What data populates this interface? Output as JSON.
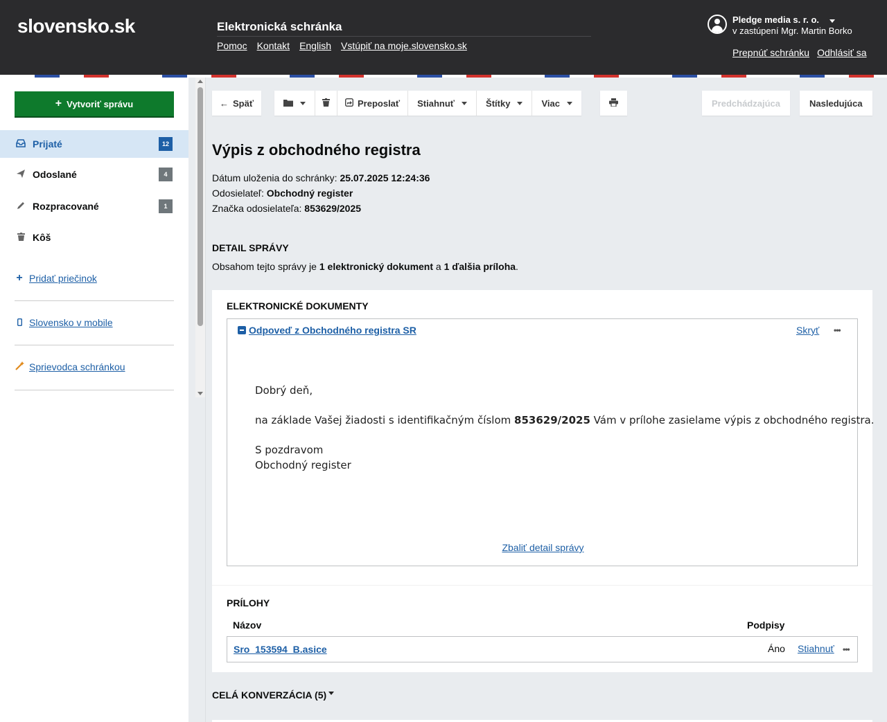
{
  "header": {
    "logo": "slovensko.sk",
    "app_title": "Elektronická schránka",
    "links": [
      "Pomoc",
      "Kontakt",
      "English",
      "Vstúpiť na moje.slovensko.sk"
    ],
    "user_name": "Pledge media s. r. o.",
    "user_sub": "v zastúpení Mgr. Martin Borko",
    "switch_link": "Prepnúť schránku",
    "logout_link": "Odhlásiť sa"
  },
  "sidebar": {
    "create_button": "Vytvoriť správu",
    "items": [
      {
        "label": "Prijaté",
        "count": "12",
        "icon": "inbox-icon",
        "active": true
      },
      {
        "label": "Odoslané",
        "count": "4",
        "icon": "paper-plane-icon"
      },
      {
        "label": "Rozpracované",
        "count": "1",
        "icon": "pencil-icon"
      },
      {
        "label": "Kôš",
        "count": "",
        "icon": "trash-icon"
      }
    ],
    "add_folder": "Pridať priečinok",
    "mobile": "Slovensko v mobile",
    "guide": "Sprievodca schránkou"
  },
  "toolbar": {
    "back": "Späť",
    "forward": "Preposlať",
    "download": "Stiahnuť",
    "tags": "Štítky",
    "more": "Viac",
    "previous": "Predchádzajúca",
    "next": "Nasledujúca"
  },
  "message": {
    "title": "Výpis z obchodného registra",
    "date_label": "Dátum uloženia do schránky:",
    "date_value": "25.07.2025 12:24:36",
    "sender_label": "Odosielateľ:",
    "sender_value": "Obchodný register",
    "ref_label": "Značka odosielateľa:",
    "ref_value": "853629/2025",
    "detail_title": "DETAIL SPRÁVY",
    "summary_pre": "Obsahom tejto správy je",
    "summary_docs": "1 elektronický dokument",
    "summary_mid": "a",
    "summary_att": "1 ďalšia príloha",
    "summary_end": "."
  },
  "documents": {
    "title": "ELEKTRONICKÉ DOKUMENTY",
    "doc_name": "Odpoveď z Obchodného registra SR",
    "hide": "Skryť",
    "greeting": "Dobrý deň,",
    "body_pre": "na základe Vašej žiadosti s identifikačným číslom",
    "body_num": "853629/2025",
    "body_post": "Vám v prílohe zasielame výpis z obchodného registra.",
    "closing": "S pozdravom",
    "signature": "Obchodný register",
    "collapse": "Zbaliť detail správy"
  },
  "attachments": {
    "title": "PRÍLOHY",
    "col_name": "Názov",
    "col_signatures": "Podpisy",
    "rows": [
      {
        "name": "Sro_153594_B.asice",
        "signed": "Áno",
        "download": "Stiahnuť"
      }
    ]
  },
  "conversation": {
    "label": "CELÁ KONVERZÁCIA (5)"
  }
}
